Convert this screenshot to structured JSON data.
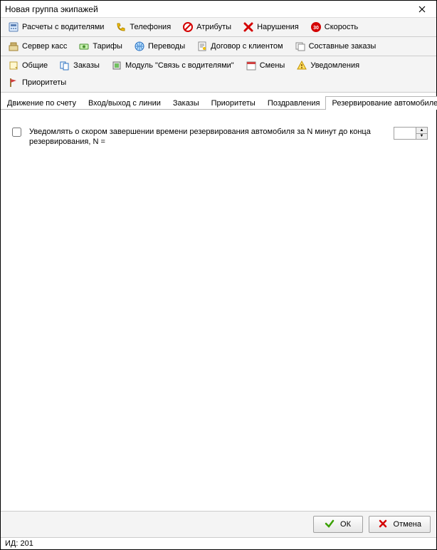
{
  "window": {
    "title": "Новая группа экипажей"
  },
  "toolbars": {
    "row1": [
      {
        "icon": "calc",
        "label": "Расчеты с водителями"
      },
      {
        "icon": "phone",
        "label": "Телефония"
      },
      {
        "icon": "forbid",
        "label": "Атрибуты"
      },
      {
        "icon": "bad",
        "label": "Нарушения"
      },
      {
        "icon": "speed",
        "label": "Скорость"
      }
    ],
    "row2": [
      {
        "icon": "cash",
        "label": "Сервер касс"
      },
      {
        "icon": "tariff",
        "label": "Тарифы"
      },
      {
        "icon": "globe",
        "label": "Переводы"
      },
      {
        "icon": "contract",
        "label": "Договор с клиентом"
      },
      {
        "icon": "compound",
        "label": "Составные заказы"
      }
    ],
    "row3": [
      {
        "icon": "common",
        "label": "Общие"
      },
      {
        "icon": "orders",
        "label": "Заказы"
      },
      {
        "icon": "module",
        "label": "Модуль \"Связь с водителями\""
      },
      {
        "icon": "shift",
        "label": "Смены"
      },
      {
        "icon": "warn",
        "label": "Уведомления"
      },
      {
        "icon": "flag",
        "label": "Приоритеты"
      }
    ]
  },
  "subtabs": [
    {
      "label": "Движение по счету"
    },
    {
      "label": "Вход/выход с линии"
    },
    {
      "label": "Заказы"
    },
    {
      "label": "Приоритеты"
    },
    {
      "label": "Поздравления"
    },
    {
      "label": "Резервирование автомобилей",
      "active": true
    }
  ],
  "content": {
    "checkbox_label": "Уведомлять о скором завершении времени резервирования автомобиля за N минут до конца резервирования, N =",
    "spin_value": ""
  },
  "footer": {
    "ok": "ОК",
    "cancel": "Отмена"
  },
  "status": {
    "id_label": "ИД: 201"
  }
}
